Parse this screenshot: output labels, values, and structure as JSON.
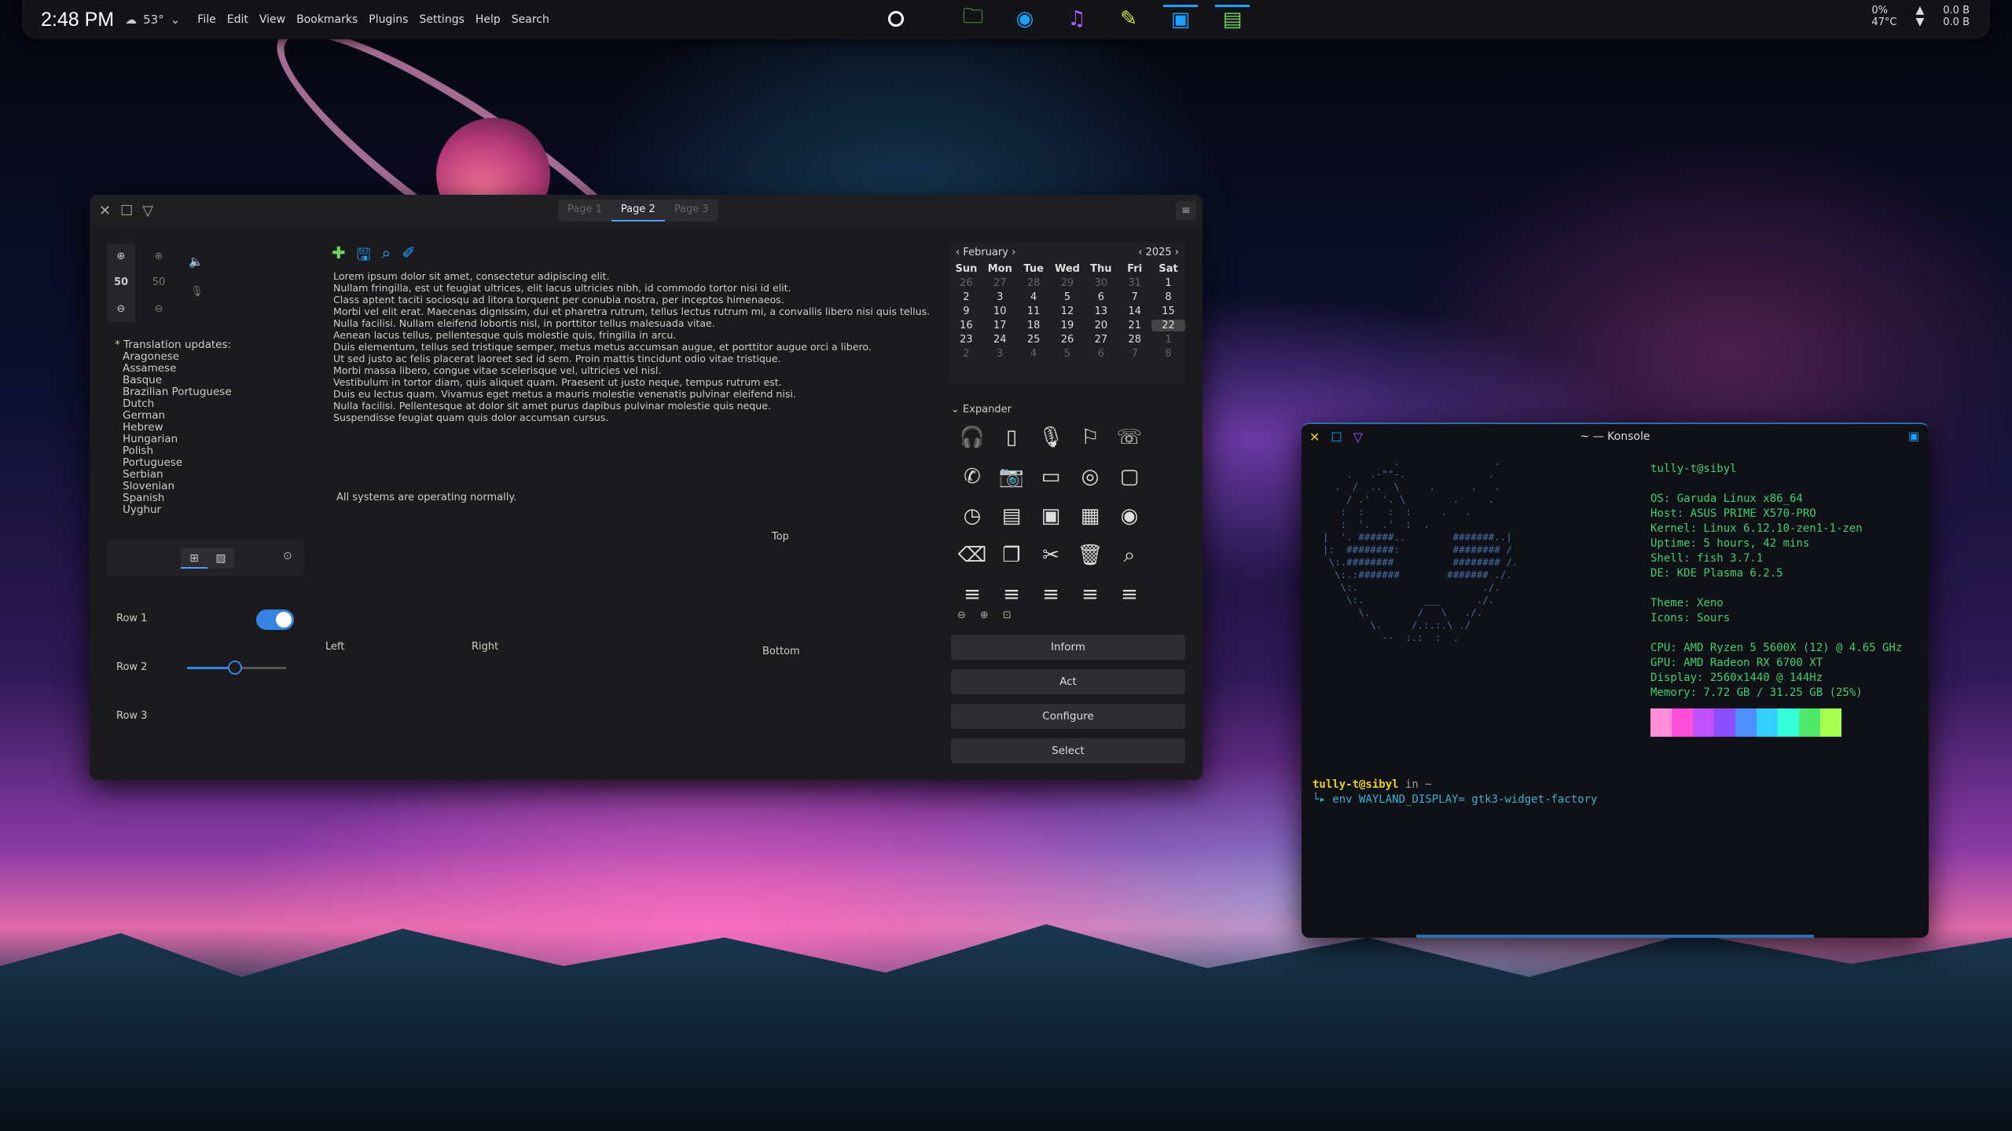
{
  "panel": {
    "clock": "2:48 PM",
    "weather": "53°",
    "menu": [
      "File",
      "Edit",
      "View",
      "Bookmarks",
      "Plugins",
      "Settings",
      "Help",
      "Search"
    ],
    "battery": "0%",
    "temp": "47°C",
    "net_up": "0.0 B",
    "net_down": "0.0 B"
  },
  "win": {
    "tabs": [
      "Page 1",
      "Page 2",
      "Page 3"
    ],
    "spin1": "50",
    "spin2": "50",
    "languages_heading": "* Translation updates:",
    "languages": [
      "Aragonese",
      "Assamese",
      "Basque",
      "Brazilian Portuguese",
      "Dutch",
      "German",
      "Hebrew",
      "Hungarian",
      "Polish",
      "Portuguese",
      "Serbian",
      "Slovenian",
      "Spanish",
      "Uyghur"
    ],
    "lorem": "Lorem ipsum dolor sit amet, consectetur adipiscing elit.\nNullam fringilla, est ut feugiat ultrices, elit lacus ultricies nibh, id commodo tortor nisi id elit.\nClass aptent taciti sociosqu ad litora torquent per conubia nostra, per inceptos himenaeos.\nMorbi vel elit erat. Maecenas dignissim, dui et pharetra rutrum, tellus lectus rutrum mi, a convallis libero nisi quis tellus.\nNulla facilisi. Nullam eleifend lobortis nisl, in porttitor tellus malesuada vitae.\nAenean lacus tellus, pellentesque quis molestie quis, fringilla in arcu.\nDuis elementum, tellus sed tristique semper, metus metus accumsan augue, et porttitor augue orci a libero.\nUt sed justo ac felis placerat laoreet sed id sem. Proin mattis tincidunt odio vitae tristique.\nMorbi massa libero, congue vitae scelerisque vel, ultricies vel nisl.\nVestibulum in tortor diam, quis aliquet quam. Praesent ut justo neque, tempus rutrum est.\nDuis eu lectus quam. Vivamus eget metus a mauris molestie venenatis pulvinar eleifend nisi.\nNulla facilisi. Pellentesque at dolor sit amet purus dapibus pulvinar molestie quis neque.\nSuspendisse feugiat quam quis dolor accumsan cursus.",
    "status": "All systems are operating normally.",
    "top": "Top",
    "left": "Left",
    "right": "Right",
    "bottom": "Bottom",
    "row1": "Row 1",
    "row2": "Row 2",
    "row3": "Row 3",
    "cal_month": "February",
    "cal_year": "2025",
    "weekdays": [
      "Sun",
      "Mon",
      "Tue",
      "Wed",
      "Thu",
      "Fri",
      "Sat"
    ],
    "expander": "Expander",
    "buttons": [
      "Inform",
      "Act",
      "Configure",
      "Select"
    ]
  },
  "konsole": {
    "title": "~ — Konsole",
    "user": "tully-t@sibyl",
    "info": "OS: Garuda Linux x86_64\nHost: ASUS PRIME X570-PRO\nKernel: Linux 6.12.10-zen1-1-zen\nUptime: 5 hours, 42 mins\nShell: fish 3.7.1\nDE: KDE Plasma 6.2.5\n\nTheme: Xeno\nIcons: Sours\n\nCPU: AMD Ryzen 5 5600X (12) @ 4.65 GHz\nGPU: AMD Radeon RX 6700 XT\nDisplay: 2560x1440 @ 144Hz\nMemory: 7.72 GB / 31.25 GB (25%)",
    "prompt_user": "tully-t@sibyl",
    "prompt_in": " in ~",
    "command": "env WAYLAND_DISPLAY= gtk3-widget-factory",
    "swatches": [
      "#ff8ed8",
      "#ff4fd8",
      "#c04fff",
      "#8a4fff",
      "#4f8fff",
      "#33d0ff",
      "#33ffd8",
      "#4fe86a",
      "#a6ff4f"
    ]
  }
}
